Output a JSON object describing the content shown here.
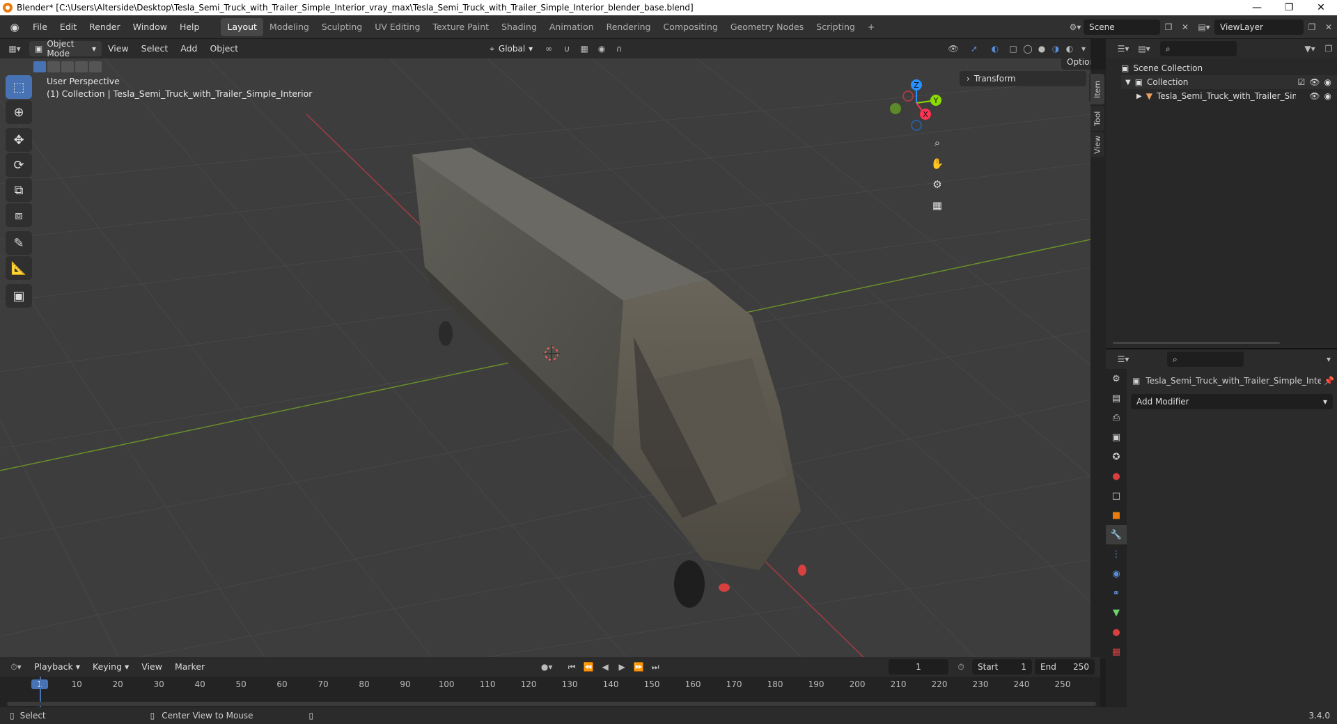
{
  "window": {
    "title": "Blender* [C:\\Users\\Alterside\\Desktop\\Tesla_Semi_Truck_with_Trailer_Simple_Interior_vray_max\\Tesla_Semi_Truck_with_Trailer_Simple_Interior_blender_base.blend]",
    "minimize": "—",
    "restore": "❐",
    "close": "✕"
  },
  "menu": [
    "File",
    "Edit",
    "Render",
    "Window",
    "Help"
  ],
  "workspaces": [
    "Layout",
    "Modeling",
    "Sculpting",
    "UV Editing",
    "Texture Paint",
    "Shading",
    "Animation",
    "Rendering",
    "Compositing",
    "Geometry Nodes",
    "Scripting",
    "+"
  ],
  "active_workspace": "Layout",
  "scene": {
    "name": "Scene",
    "view_layer": "ViewLayer"
  },
  "viewport_header": {
    "mode": "Object Mode",
    "menus": [
      "View",
      "Select",
      "Add",
      "Object"
    ],
    "orientation": "Global",
    "options": "Options"
  },
  "viewport": {
    "perspective": "User Perspective",
    "collection_info": "(1) Collection | Tesla_Semi_Truck_with_Trailer_Simple_Interior",
    "transform_label": "Transform",
    "tabs": [
      "Item",
      "Tool",
      "View"
    ],
    "gizmo": {
      "x": "X",
      "y": "Y",
      "z": "Z"
    }
  },
  "outliner": {
    "root": "Scene Collection",
    "collection": "Collection",
    "object": "Tesla_Semi_Truck_with_Trailer_Sim"
  },
  "properties": {
    "object_name": "Tesla_Semi_Truck_with_Trailer_Simple_Inte...",
    "add_modifier": "Add Modifier"
  },
  "timeline": {
    "menus": [
      "Playback",
      "Keying",
      "View",
      "Marker"
    ],
    "current_frame": "1",
    "start_label": "Start",
    "start": "1",
    "end_label": "End",
    "end": "250",
    "ticks": [
      "1",
      "10",
      "20",
      "30",
      "40",
      "50",
      "60",
      "70",
      "80",
      "90",
      "100",
      "110",
      "120",
      "130",
      "140",
      "150",
      "160",
      "170",
      "180",
      "190",
      "200",
      "210",
      "220",
      "230",
      "240",
      "250"
    ]
  },
  "status": {
    "left": "Select",
    "middle": "Center View to Mouse",
    "version": "3.4.0"
  },
  "colors": {
    "accent": "#4772b3",
    "axis_x": "#ff3352",
    "axis_y": "#8bdc00",
    "axis_z": "#2890ff",
    "orange": "#e87d0d"
  }
}
